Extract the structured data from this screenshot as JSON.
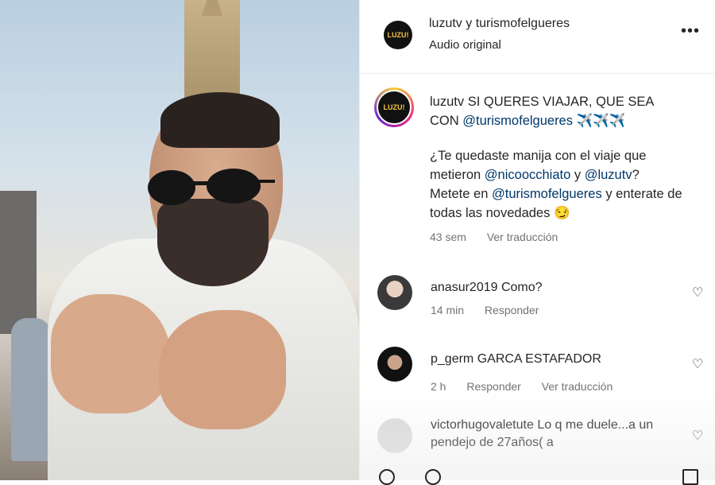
{
  "header": {
    "title": "luzutv y turismofelgueres",
    "subtitle": "Audio original",
    "avatar_text": "LUZU!"
  },
  "caption": {
    "username": "luzutv",
    "line1_text": "SI QUERES VIAJAR, QUE SEA",
    "line2_prefix": "CON",
    "mention1": "@turismofelgueres",
    "emoji1": "✈️✈️✈️",
    "p2_a": "¿Te quedaste manija con el viaje que metieron",
    "mention2": "@nicoocchiato",
    "p2_b": "y",
    "mention3": "@luzutv",
    "p2_c": "?",
    "p3_a": "Metete en",
    "mention4": "@turismofelgueres",
    "p3_b": "y enterate de todas las novedades",
    "emoji2": "😏",
    "time": "43 sem",
    "translate": "Ver traducción",
    "avatar_text": "LUZU!"
  },
  "comments": [
    {
      "user": "anasur2019",
      "text": "Como?",
      "time": "14 min",
      "reply": "Responder",
      "translate": ""
    },
    {
      "user": "p_germ",
      "text": "GARCA ESTAFADOR",
      "time": "2 h",
      "reply": "Responder",
      "translate": "Ver traducción"
    },
    {
      "user": "victorhugovaletute",
      "text": "Lo q me duele...a un pendejo de 27años( a",
      "time": "",
      "reply": "",
      "translate": ""
    }
  ],
  "icons": {
    "more": "more-options-icon",
    "heart": "heart-icon"
  }
}
